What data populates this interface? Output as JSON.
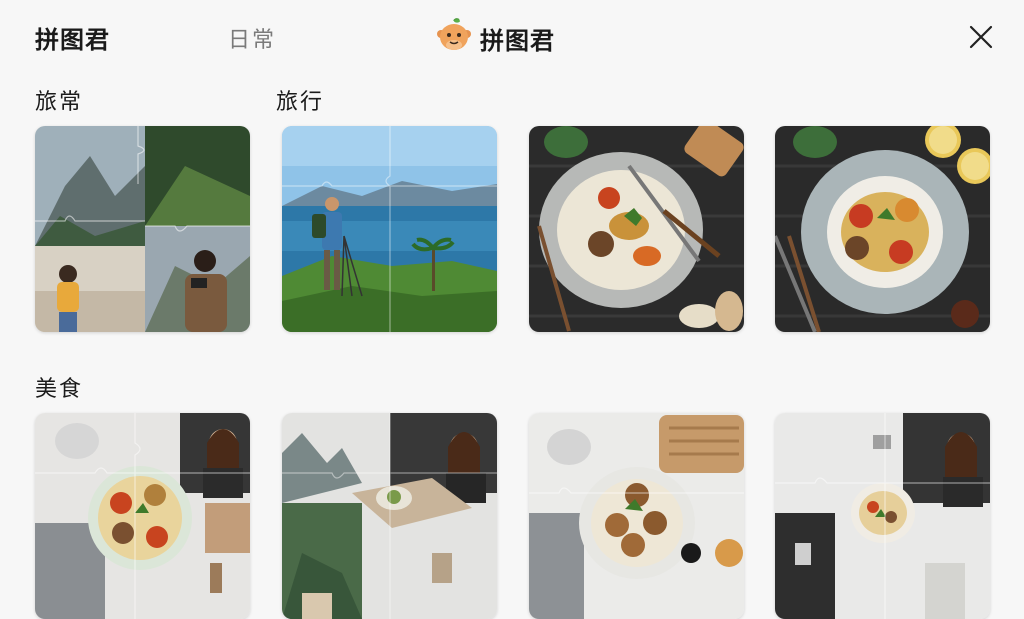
{
  "header": {
    "app_title": "拼图君",
    "tab_daily": "日常",
    "brand_name": "拼图君",
    "close_icon": "close-icon",
    "logo_icon": "mascot-logo-icon"
  },
  "sections": {
    "lvchang": "旅常",
    "lvxing": "旅行",
    "meishi": "美食"
  },
  "tiles": {
    "row1": [
      "mountain-photographer-puzzle",
      "hiker-lake-puzzle",
      "food-plate-puzzle",
      "food-bowl-puzzle"
    ],
    "row2": [
      "food-portrait-puzzle",
      "mountain-portrait-puzzle",
      "food-tray-puzzle",
      "food-portrait-puzzle-2"
    ]
  },
  "colors": {
    "background": "#f7f7f7",
    "mascot": "#f0a35c"
  }
}
